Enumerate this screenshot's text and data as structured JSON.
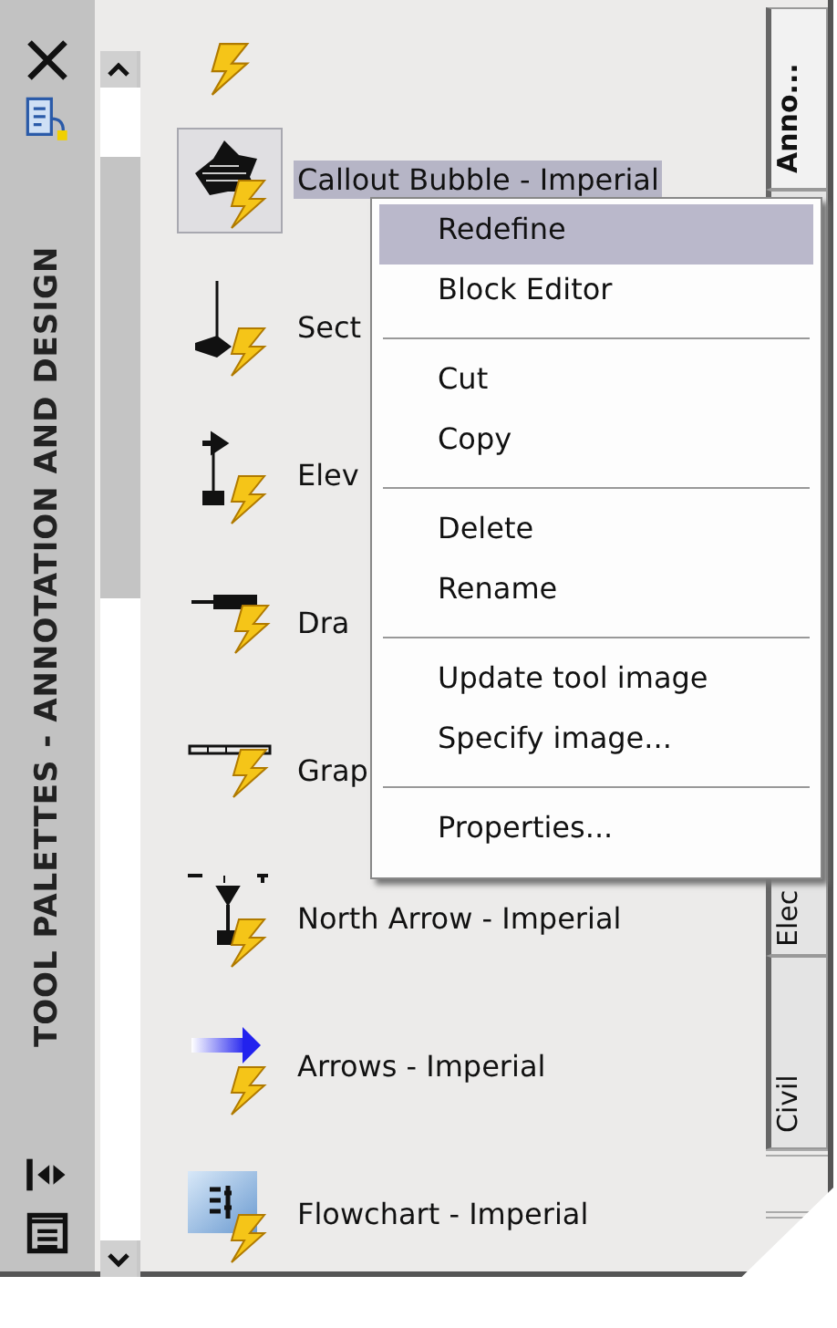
{
  "palette": {
    "title": "TOOL PALETTES - ANNOTATION AND DESIGN"
  },
  "tools": [
    {
      "selected": false
    },
    {
      "label": "Callout Bubble - Imperial",
      "selected": true
    },
    {
      "label": "Sect",
      "selected": false
    },
    {
      "label": "Elev",
      "selected": false
    },
    {
      "label": "Dra",
      "selected": false
    },
    {
      "label": "Grap",
      "selected": false
    },
    {
      "label": "North Arrow - Imperial",
      "selected": false
    },
    {
      "label": "Arrows - Imperial",
      "selected": false
    },
    {
      "label": "Flowchart - Imperial",
      "selected": false
    }
  ],
  "tabs": [
    {
      "label": "Anno...",
      "selected": true
    },
    {
      "label": "Elec",
      "selected": false
    },
    {
      "label": "Civil",
      "selected": false
    }
  ],
  "context_menu": {
    "groups": [
      [
        {
          "label": "Redefine",
          "selected": true
        },
        {
          "label": "Block Editor",
          "selected": false
        }
      ],
      [
        {
          "label": "Cut",
          "selected": false
        },
        {
          "label": "Copy",
          "selected": false
        }
      ],
      [
        {
          "label": "Delete",
          "selected": false
        },
        {
          "label": "Rename",
          "selected": false
        }
      ],
      [
        {
          "label": "Update tool image",
          "selected": false
        },
        {
          "label": "Specify image...",
          "selected": false
        }
      ],
      [
        {
          "label": "Properties...",
          "selected": false
        }
      ]
    ]
  }
}
